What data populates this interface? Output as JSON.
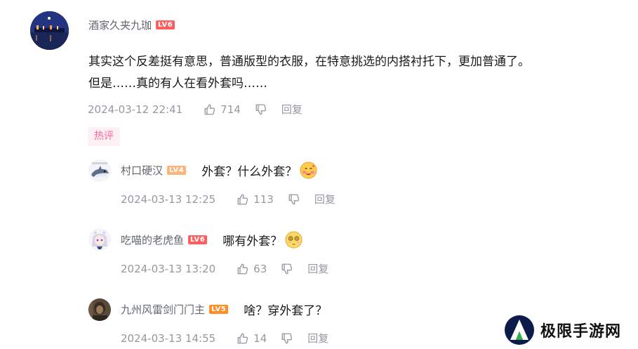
{
  "main_comment": {
    "username": "酒家久夹九珈",
    "level": "LV6",
    "content_line1": "其实这个反差挺有意思，普通版型的衣服，在特意挑选的内搭衬托下，更加普通了。",
    "content_line2": "但是……真的有人在看外套吗……",
    "time": "2024-03-12 22:41",
    "likes": "714",
    "reply_label": "回复",
    "badge": "热评"
  },
  "replies": [
    {
      "username": "村口硬汉",
      "level": "LV4",
      "text": "外套？什么外套？",
      "emoji": "blushing-emoji",
      "time": "2024-03-13 12:25",
      "likes": "113",
      "reply_label": "回复"
    },
    {
      "username": "吃喵的老虎鱼",
      "level": "LV6",
      "text": "哪有外套？",
      "emoji": "dazed-emoji",
      "time": "2024-03-13 13:20",
      "likes": "63",
      "reply_label": "回复"
    },
    {
      "username": "九州风雷剑门门主",
      "level": "LV5",
      "text": "啥？穿外套了？",
      "emoji": "",
      "time": "2024-03-13 14:55",
      "likes": "14",
      "reply_label": "回复"
    }
  ],
  "watermark": {
    "text": "极限手游网"
  },
  "colors": {
    "text": "#18191c",
    "muted": "#9499a0",
    "username": "#61666d",
    "hot_badge": "#ff6699",
    "lv6": "#ff5e5e",
    "lv5": "#ff8e29",
    "lv4": "#ffb37c"
  },
  "icons": [
    "thumbs-up-icon",
    "thumbs-down-icon"
  ]
}
